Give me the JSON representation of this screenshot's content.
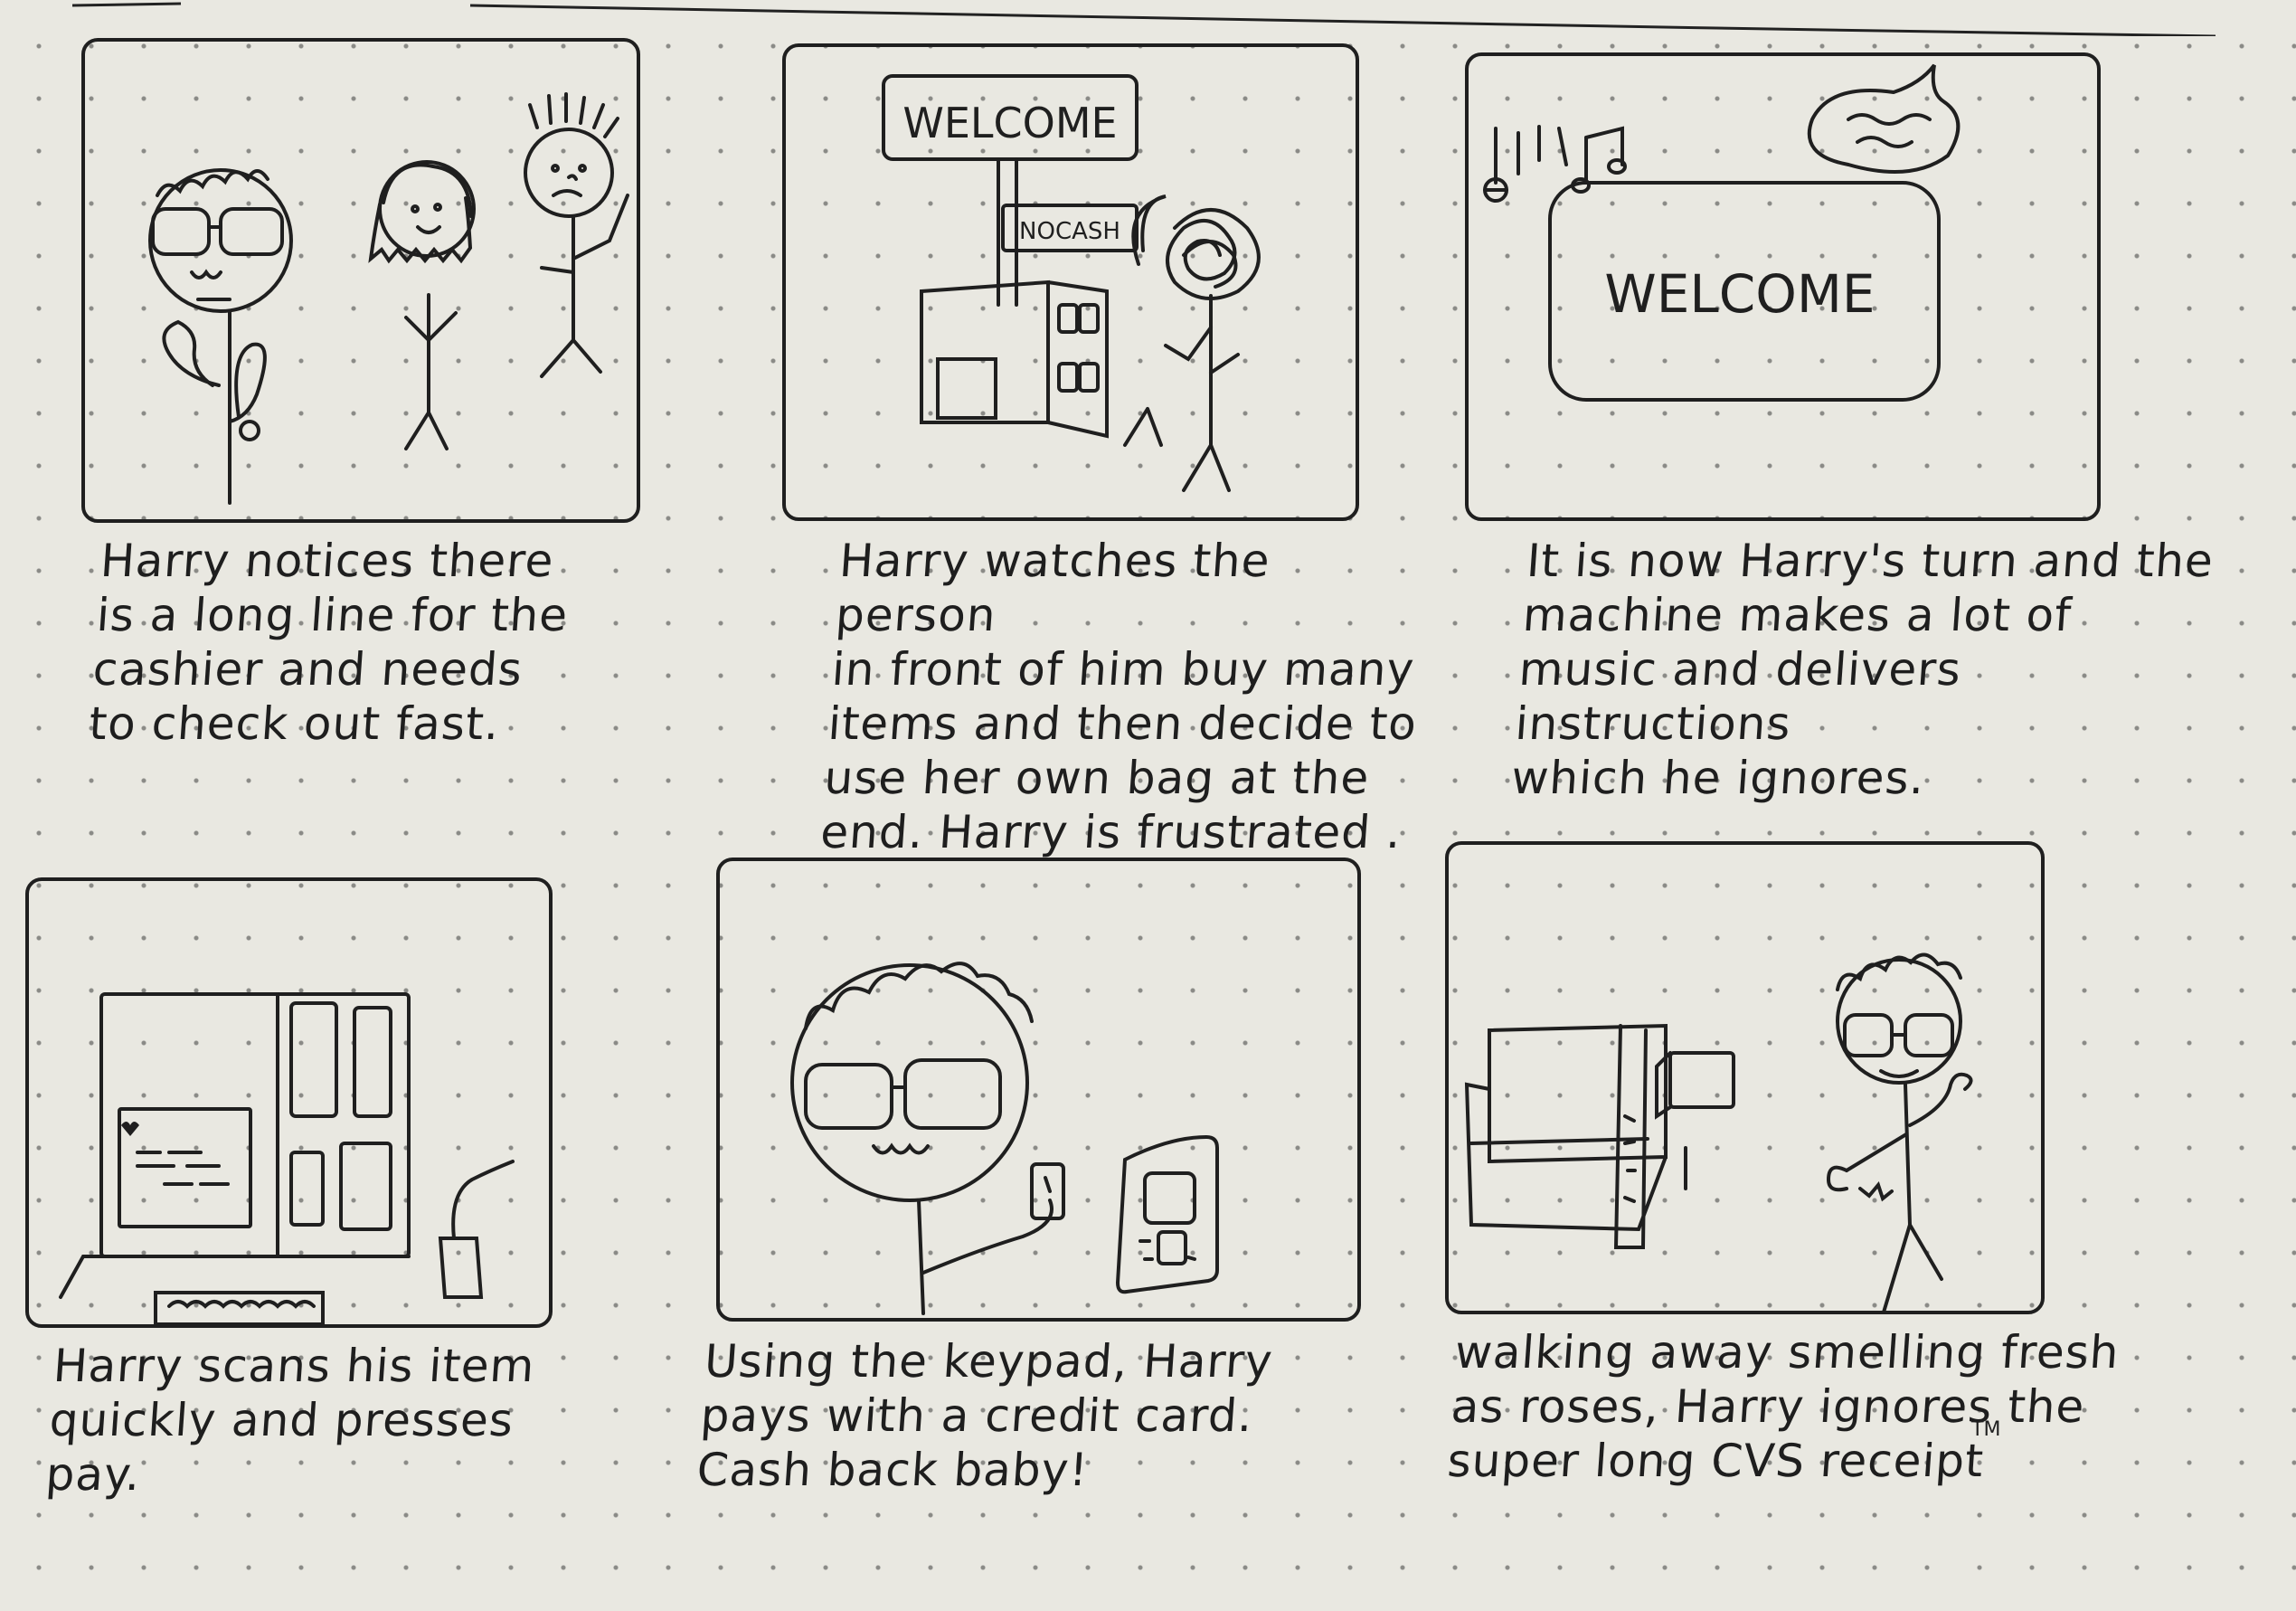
{
  "panels": [
    {
      "caption": "Harry notices there\nis a long line for the\ncashier and needs\nto check out fast.",
      "icons": [
        "harry-stick-figure-icon",
        "woman-stick-figure-icon",
        "frowning-man-stick-figure-icon"
      ]
    },
    {
      "caption": "Harry watches the person\nin front of him buy many\nitems and then decide to\nuse her own bag at the\nend. Harry is frustrated .",
      "sign_welcome": "WELCOME",
      "sign_nocash": "NOCASH",
      "icons": [
        "self-checkout-kiosk-icon",
        "shopper-stick-figure-icon"
      ]
    },
    {
      "caption": "It is now Harry's turn and the\nmachine makes a lot of\nmusic and delivers instructions\nwhich he ignores.",
      "screen_text": "WELCOME",
      "icons": [
        "music-notes-icon",
        "speech-bubble-icon",
        "screen-icon"
      ]
    },
    {
      "caption": "Harry scans his item\nquickly and presses\npay.",
      "icons": [
        "kiosk-screen-icon",
        "receipt-list-icon",
        "scanner-icon",
        "hand-icon"
      ]
    },
    {
      "caption": "Using the keypad, Harry\npays with a credit card.\nCash back baby!",
      "icons": [
        "harry-face-icon",
        "credit-card-icon",
        "keypad-icon"
      ]
    },
    {
      "caption": "walking away smelling fresh\nas roses, Harry ignores the\nsuper long CVS receipt",
      "trademark": "TM",
      "icons": [
        "printer-icon",
        "long-receipt-icon",
        "harry-walking-icon"
      ]
    }
  ]
}
